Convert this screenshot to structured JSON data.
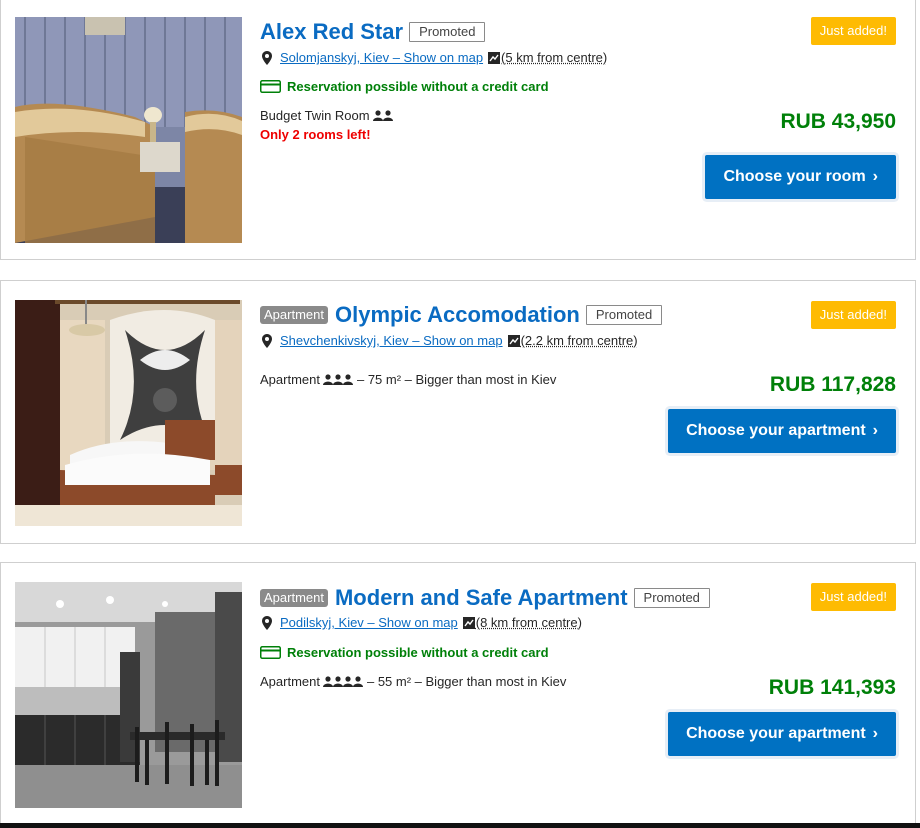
{
  "listings": [
    {
      "name": "Alex Red Star",
      "type_badge": "",
      "promoted": "Promoted",
      "location": "Solomjanskyj, Kiev – Show on map",
      "distance": "(5 km from centre)",
      "credit_note": "Reservation possible without a credit card",
      "room": "Budget Twin Room",
      "occupancy_icon": "two-people-icon",
      "rooms_left": "Only 2 rooms left!",
      "just_added": "Just added!",
      "price": "RUB 43,950",
      "button": "Choose your room"
    },
    {
      "name": "Olympic Accomodation",
      "type_badge": "Apartment",
      "promoted": "Promoted",
      "location": "Shevchenkivskyj, Kiev – Show on map",
      "distance": "(2.2 km from centre)",
      "room": "Apartment",
      "occupancy_icon": "three-people-icon",
      "room_detail": "– 75 m² – Bigger than most in Kiev",
      "just_added": "Just added!",
      "price": "RUB 117,828",
      "button": "Choose your apartment"
    },
    {
      "name": "Modern and Safe Apartment",
      "type_badge": "Apartment",
      "promoted": "Promoted",
      "location": "Podilskyj, Kiev – Show on map",
      "distance": "(8 km from centre)",
      "credit_note": "Reservation possible without a credit card",
      "room": "Apartment",
      "occupancy_icon": "four-people-icon",
      "room_detail": "– 55 m² – Bigger than most in Kiev",
      "just_added": "Just added!",
      "price": "RUB 141,393",
      "button": "Choose your apartment"
    }
  ],
  "colors": {
    "link_blue": "#0a6bc2",
    "button_blue": "#0071c2",
    "price_green": "#008009",
    "badge_yellow": "#febb02",
    "urgent_red": "#e00000"
  }
}
